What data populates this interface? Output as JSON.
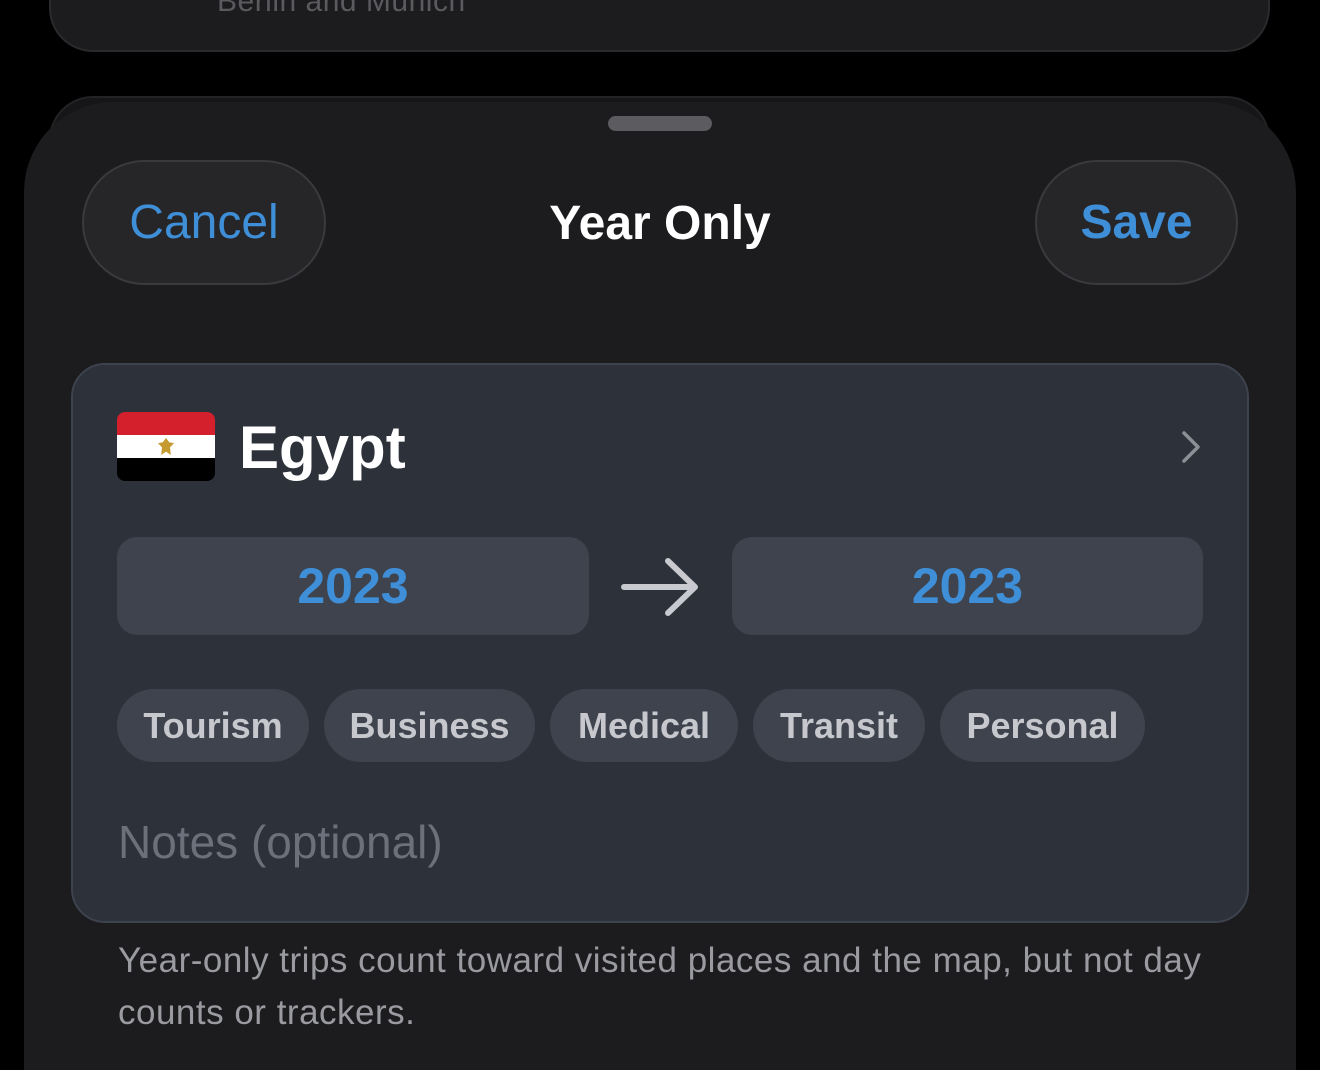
{
  "background_card": {
    "subtitle": "Berlin and Munich"
  },
  "header": {
    "cancel_label": "Cancel",
    "title": "Year Only",
    "save_label": "Save"
  },
  "trip": {
    "country": "Egypt",
    "flag_icon": "egypt-flag-icon",
    "start_year": "2023",
    "end_year": "2023",
    "categories": [
      "Tourism",
      "Business",
      "Medical",
      "Transit",
      "Personal"
    ],
    "notes_placeholder": "Notes (optional)"
  },
  "footer": {
    "note": "Year-only trips count toward visited places and the map, but not day counts or trackers."
  },
  "colors": {
    "accent": "#3f8fd8",
    "sheet_bg": "#1c1c1e",
    "card_bg": "#2c313a",
    "chip_bg": "#3e434d"
  }
}
